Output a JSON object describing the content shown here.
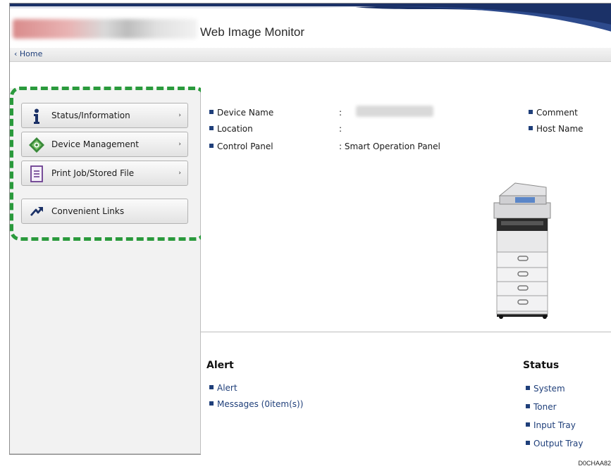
{
  "header": {
    "app_title": "Web Image Monitor"
  },
  "breadcrumb": {
    "home_label": "Home",
    "home_glyph": "‹"
  },
  "sidebar": {
    "items": [
      {
        "label": "Status/Information",
        "icon": "info-icon",
        "arrow": "›"
      },
      {
        "label": "Device Management",
        "icon": "device-management-icon",
        "arrow": "›"
      },
      {
        "label": "Print Job/Stored File",
        "icon": "document-icon",
        "arrow": "›"
      },
      {
        "label": "Convenient Links",
        "icon": "link-arrow-icon"
      }
    ],
    "highlight_color": "#2a9a3c"
  },
  "device_info": {
    "rows": [
      {
        "label": "Device Name",
        "value": ":"
      },
      {
        "label": "Location",
        "value": ":"
      },
      {
        "label": "Control Panel",
        "value": ": Smart Operation Panel"
      }
    ],
    "right_rows": [
      {
        "label": "Comment"
      },
      {
        "label": "Host Name"
      }
    ]
  },
  "alert": {
    "heading": "Alert",
    "links": [
      "Alert",
      "Messages (0item(s))"
    ]
  },
  "status": {
    "heading": "Status",
    "links": [
      "System",
      "Toner",
      "Input Tray",
      "Output Tray"
    ]
  },
  "figure_code": "D0CHAA82",
  "colors": {
    "link": "#1f3f7a",
    "accent_navy": "#1b3167"
  }
}
